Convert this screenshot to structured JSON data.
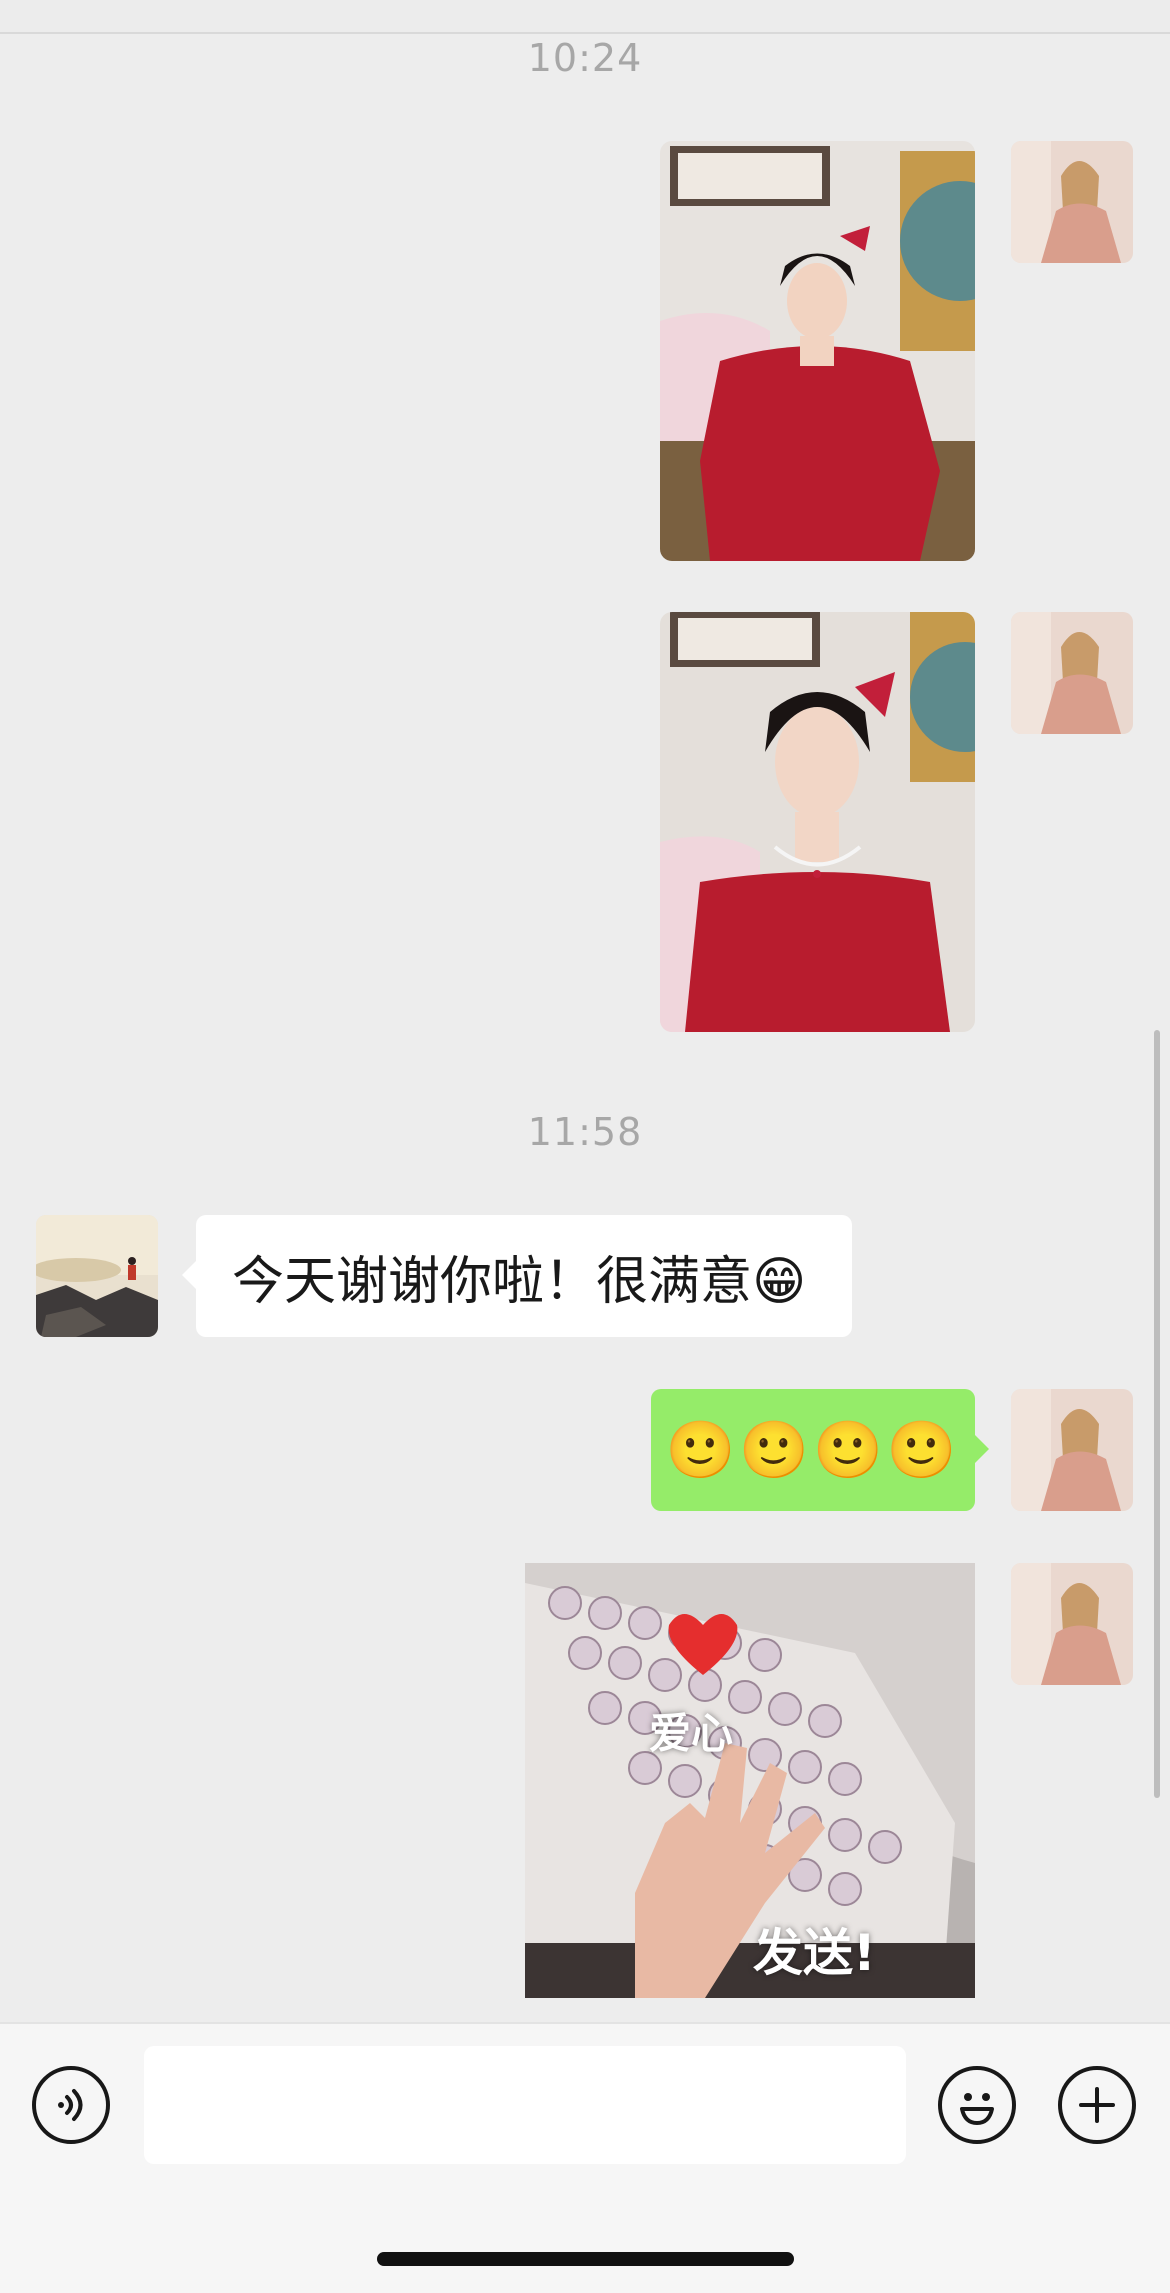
{
  "chat": {
    "messages": [
      {
        "type": "timestamp",
        "text": "10:24"
      },
      {
        "type": "image",
        "sender": "me",
        "alt": "photo-red-dress-sitting"
      },
      {
        "type": "image",
        "sender": "me",
        "alt": "photo-red-dress-portrait"
      },
      {
        "type": "timestamp",
        "text": "11:58"
      },
      {
        "type": "text",
        "sender": "other",
        "text": "今天谢谢你啦！很满意😁"
      },
      {
        "type": "text",
        "sender": "me",
        "text": "🙂🙂🙂🙂"
      },
      {
        "type": "sticker",
        "sender": "me",
        "caption_top": "爱心",
        "caption_bottom": "发送!"
      }
    ]
  },
  "input": {
    "placeholder": ""
  },
  "icons": {
    "voice": "voice-icon",
    "emoji": "emoji-icon",
    "add": "plus-icon"
  },
  "colors": {
    "background": "#ededed",
    "outgoing_bubble": "#95ec69",
    "incoming_bubble": "#ffffff"
  }
}
